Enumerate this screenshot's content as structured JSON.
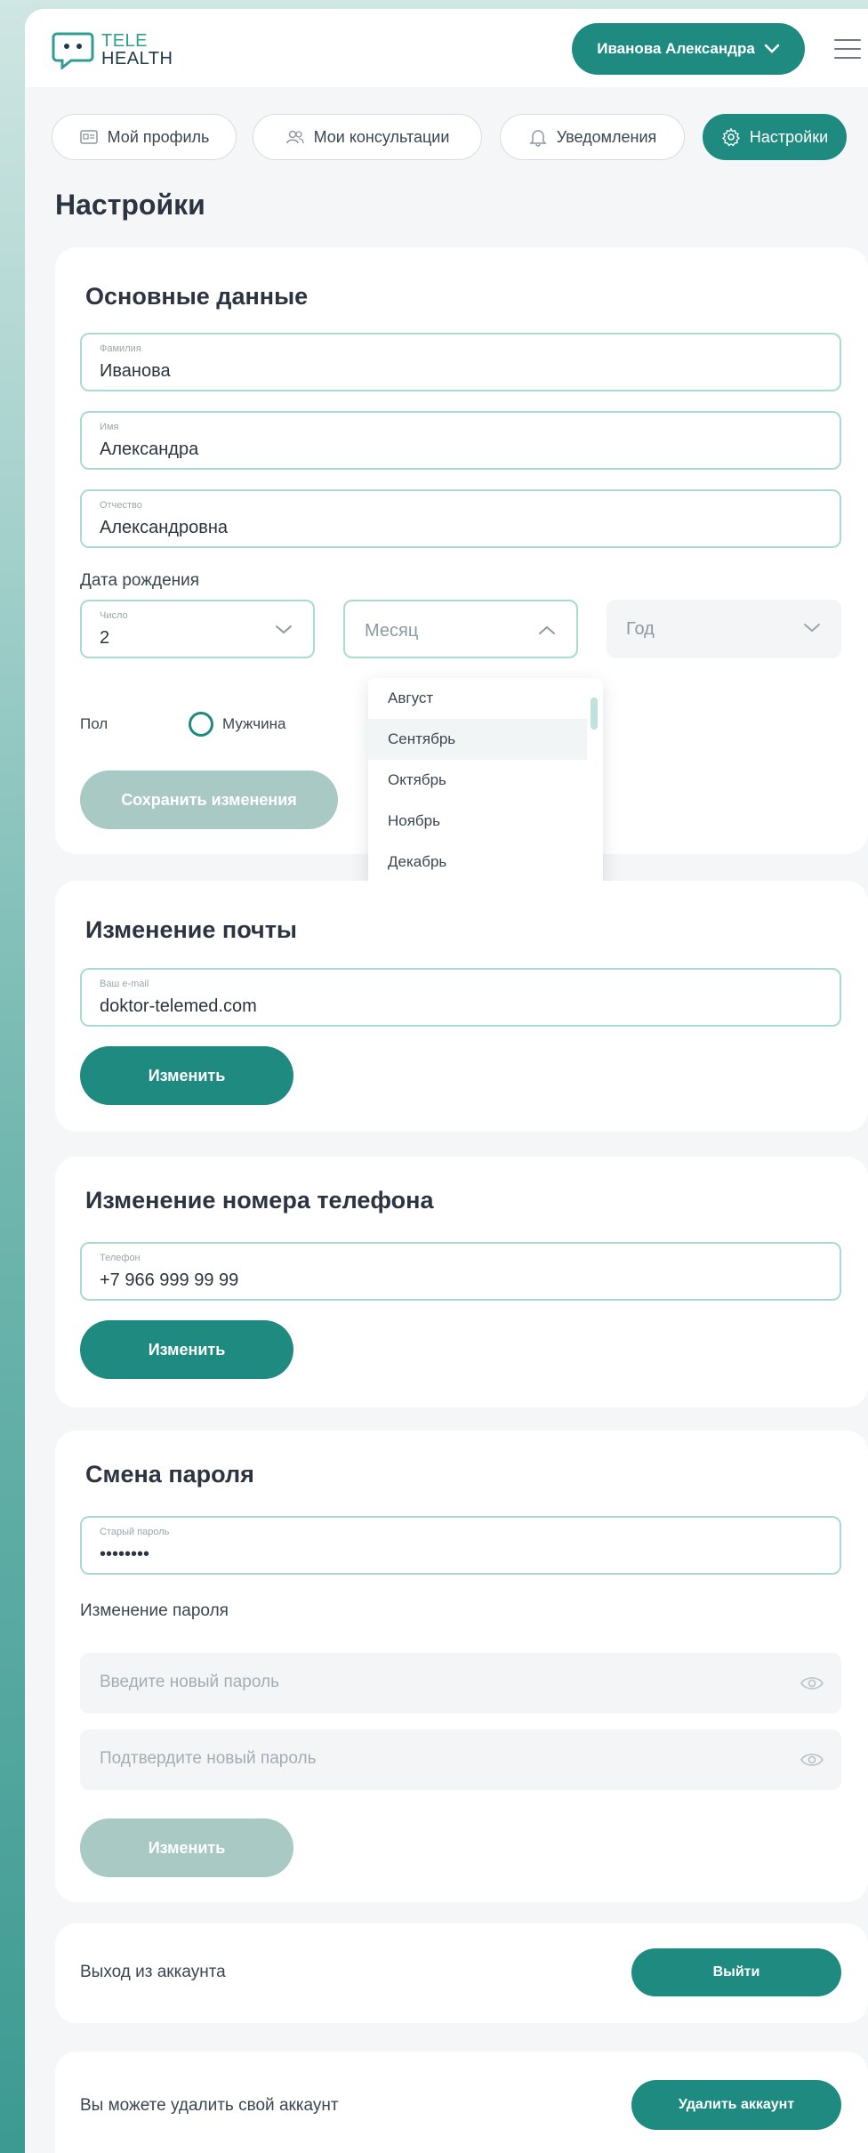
{
  "colors": {
    "accent": "#1e8a80",
    "disabled": "#a9c9c4",
    "field_border": "#a9dad4"
  },
  "header": {
    "logo": {
      "line1": "TELE",
      "line2": "HEALTH"
    },
    "user_name": "Иванова Александра"
  },
  "tabs": [
    {
      "label": "Мой профиль",
      "icon": "id-card-icon"
    },
    {
      "label": "Мои консультации",
      "icon": "users-icon"
    },
    {
      "label": "Уведомления",
      "icon": "bell-icon"
    },
    {
      "label": "Настройки",
      "icon": "gear-icon",
      "active": true
    }
  ],
  "page_title": "Настройки",
  "basic": {
    "title": "Основные данные",
    "last_name": {
      "label": "Фамилия",
      "value": "Иванова"
    },
    "first_name": {
      "label": "Имя",
      "value": "Александра"
    },
    "patronymic": {
      "label": "Отчество",
      "value": "Александровна"
    },
    "birth_label": "Дата рождения",
    "day": {
      "label": "Число",
      "value": "2"
    },
    "month": {
      "placeholder": "Месяц"
    },
    "year": {
      "placeholder": "Год"
    },
    "month_options": [
      "Август",
      "Сентябрь",
      "Октябрь",
      "Ноябрь",
      "Декабрь"
    ],
    "gender_label": "Пол",
    "gender_male": "Мужчина",
    "save_label": "Сохранить изменения"
  },
  "email": {
    "title": "Изменение почты",
    "label": "Ваш e-mail",
    "value": "doktor-telemed.com",
    "button": "Изменить"
  },
  "phone": {
    "title": "Изменение номера телефона",
    "label": "Телефон",
    "value": "+7 966 999 99 99",
    "button": "Изменить"
  },
  "password": {
    "title": "Смена пароля",
    "old_label": "Старый пароль",
    "old_value": "••••••••",
    "change_label": "Изменение пароля",
    "new_placeholder": "Введите новый пароль",
    "confirm_placeholder": "Подтвердите новый пароль",
    "button": "Изменить"
  },
  "logout": {
    "text": "Выход из аккаунта",
    "button": "Выйти"
  },
  "delete": {
    "text": "Вы можете удалить свой аккаунт",
    "button": "Удалить аккаунт"
  }
}
